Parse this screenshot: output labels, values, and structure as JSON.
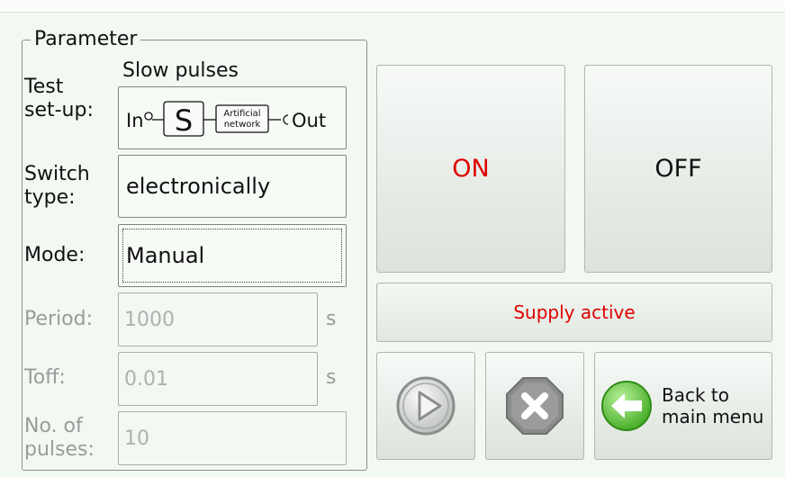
{
  "parameter": {
    "legend": "Parameter",
    "test_setup": {
      "label_line1": "Test",
      "label_line2": "set-up:",
      "title": "Slow pulses",
      "in_label": "In",
      "s_label": "S",
      "network_line1": "Artificial",
      "network_line2": "network",
      "out_label": "Out"
    },
    "switch_type": {
      "label_line1": "Switch",
      "label_line2": "type:",
      "value": "electronically"
    },
    "mode": {
      "label": "Mode:",
      "value": "Manual"
    },
    "period": {
      "label": "Period:",
      "value": "1000",
      "unit": "s"
    },
    "toff": {
      "label": "Toff:",
      "value": "0.01",
      "unit": "s"
    },
    "pulses": {
      "label_line1": "No. of",
      "label_line2": "pulses:",
      "value": "10"
    }
  },
  "controls": {
    "on_label": "ON",
    "off_label": "OFF",
    "status": "Supply active",
    "back_line1": "Back to",
    "back_line2": "main menu"
  },
  "colors": {
    "background": "#f2f8f2",
    "on_text": "#e00000",
    "status_text": "#e00000",
    "disabled_text": "#9b9b9b",
    "back_arrow": "#5cc23c"
  }
}
